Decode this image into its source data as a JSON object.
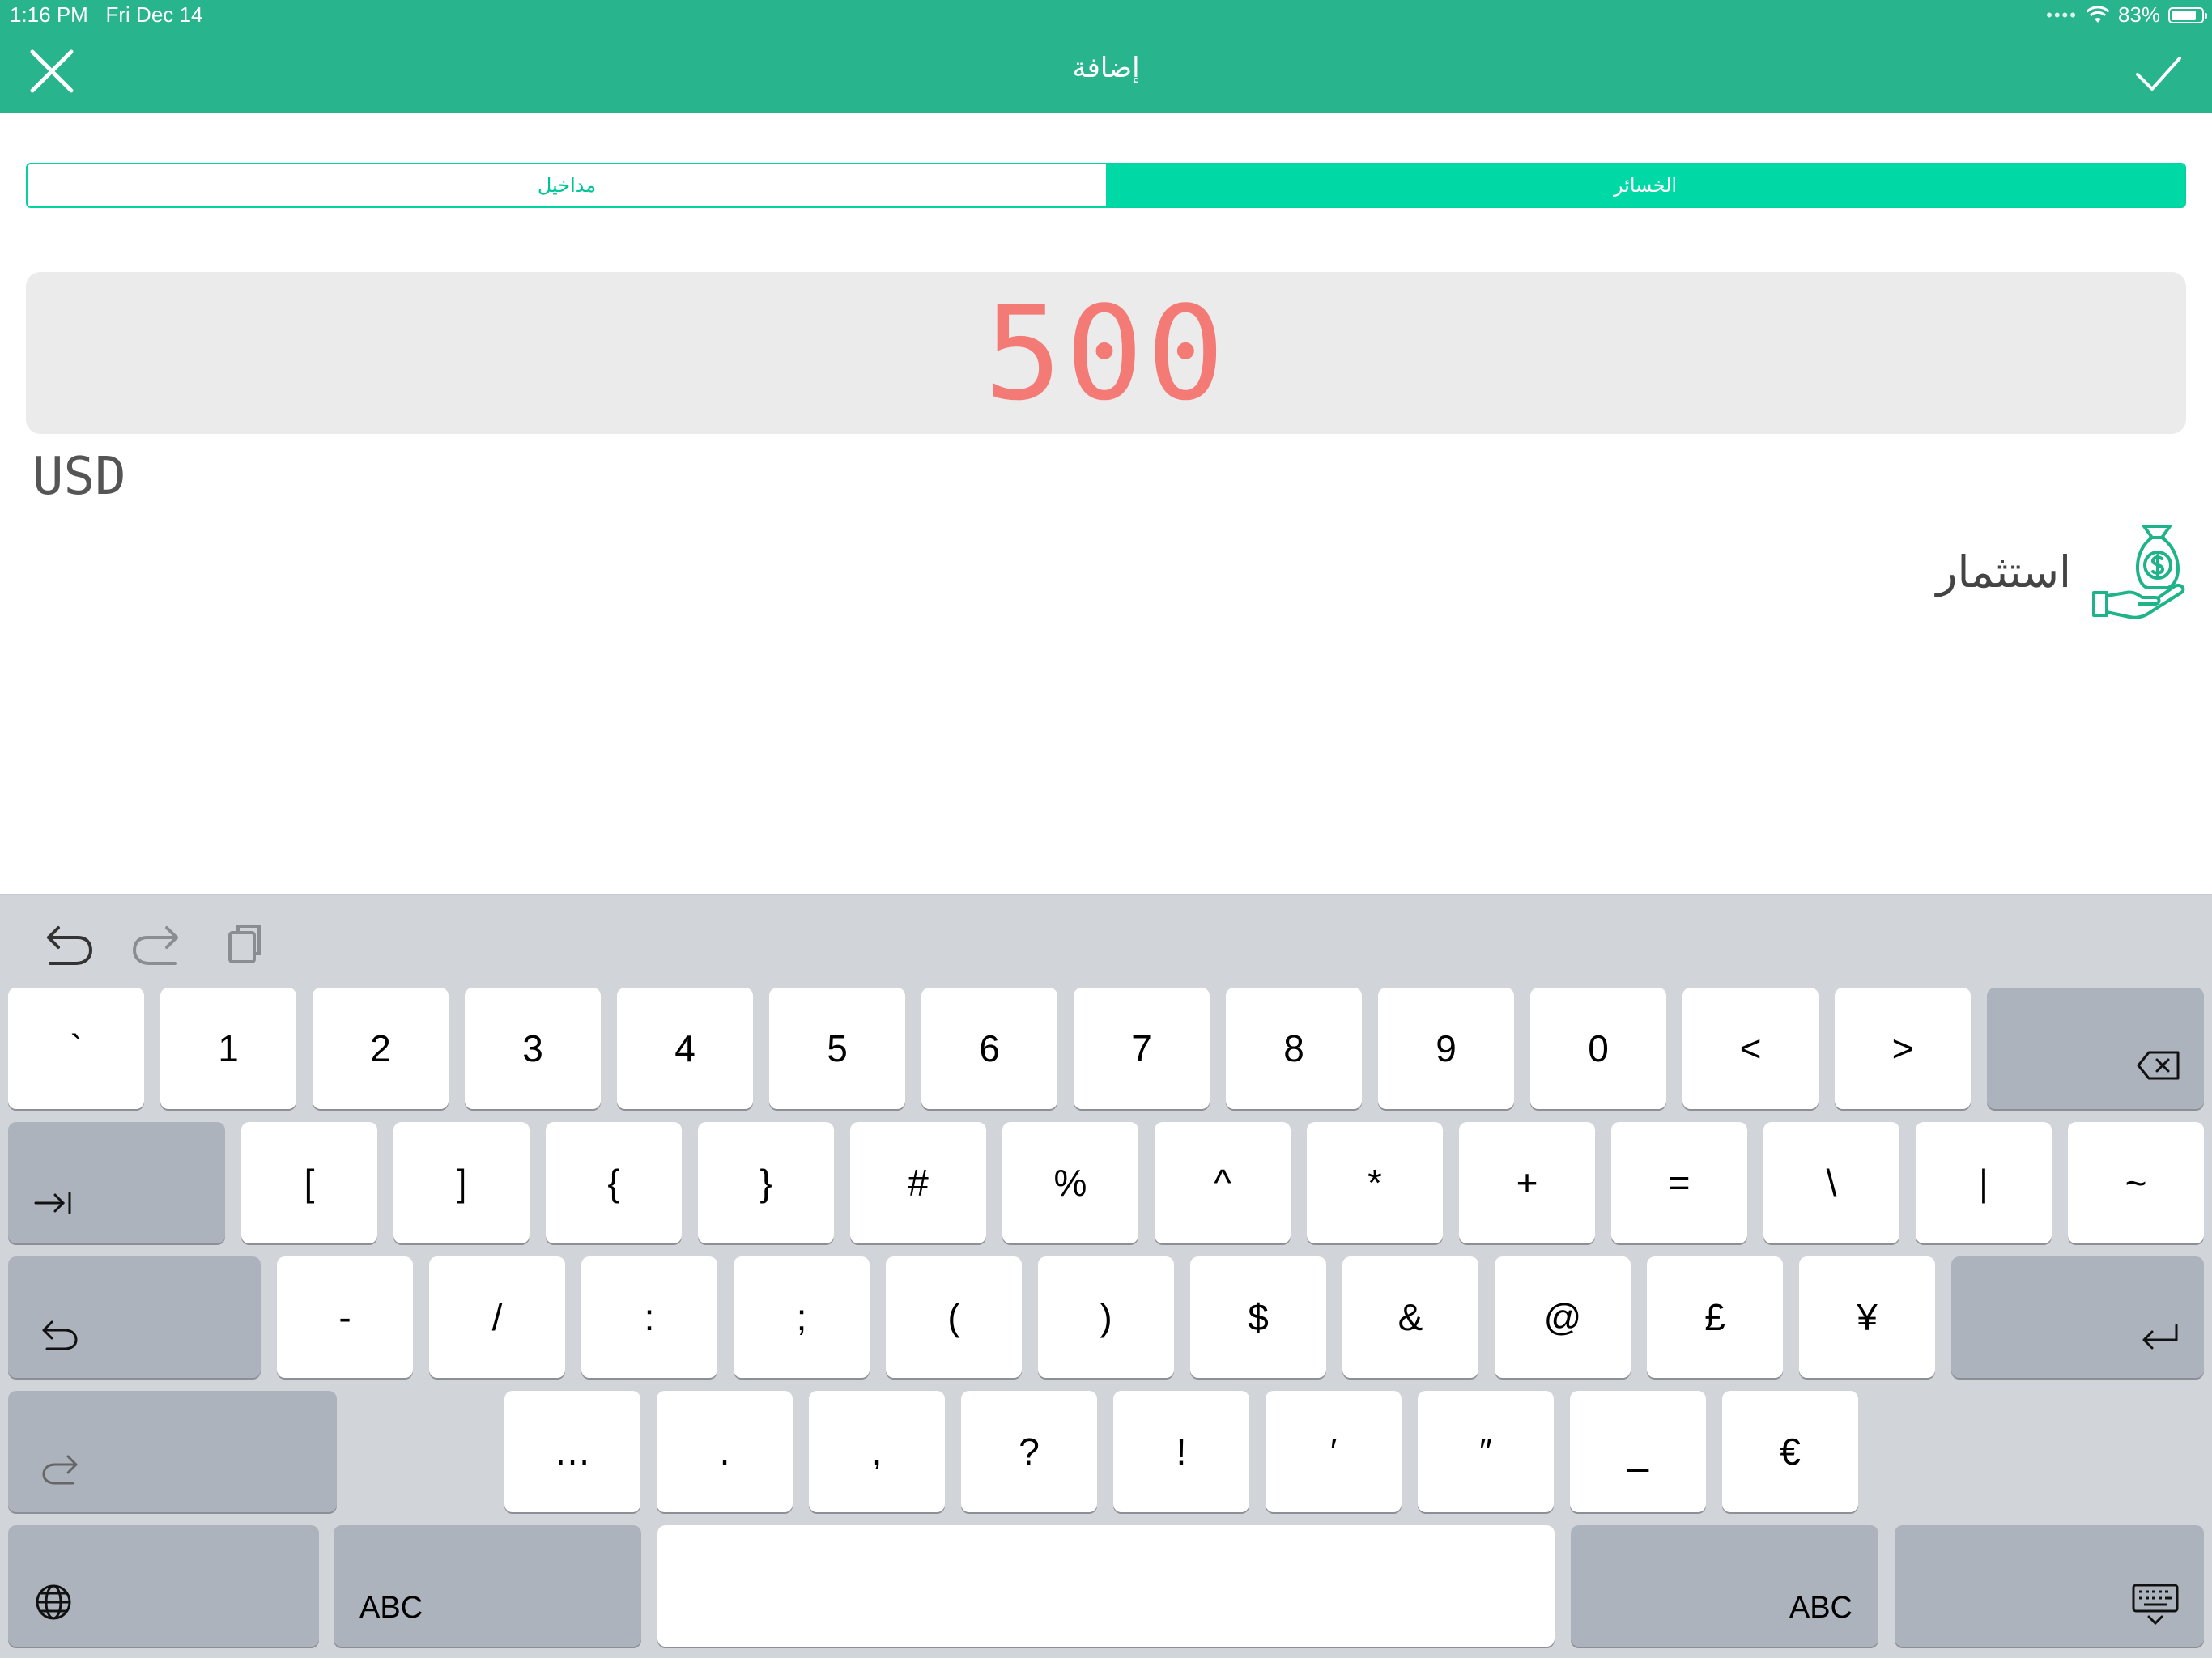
{
  "status_bar": {
    "time": "1:16 PM",
    "date": "Fri Dec 14",
    "battery": "83%",
    "battery_level": 0.83
  },
  "nav": {
    "title": "إضافة",
    "close_icon": "close-icon",
    "confirm_icon": "checkmark-icon"
  },
  "segment": {
    "income_label": "مداخيل",
    "loss_label": "الخسائر",
    "selected": "loss"
  },
  "amount": {
    "value": "500",
    "currency": "USD",
    "color": "#f47a76"
  },
  "category": {
    "label": "استثمار",
    "icon": "money-bag-hand-icon"
  },
  "colors": {
    "primary": "#28b48c",
    "segment_accent": "#00d9a6"
  },
  "keyboard": {
    "shortcuts": [
      "undo-icon",
      "redo-icon",
      "paste-icon"
    ],
    "row1": [
      "`",
      "1",
      "2",
      "3",
      "4",
      "5",
      "6",
      "7",
      "8",
      "9",
      "0",
      "<",
      ">"
    ],
    "row2": [
      "[",
      "]",
      "{",
      "}",
      "#",
      "%",
      "^",
      "*",
      "+",
      "=",
      "\\",
      "|",
      "~"
    ],
    "row3": [
      "-",
      "/",
      ":",
      ";",
      "(",
      ")",
      "$",
      "&",
      "@",
      "£",
      "¥"
    ],
    "row4": [
      "…",
      ".",
      ",",
      "?",
      "!",
      "′",
      "″",
      "_",
      "€"
    ],
    "abc_left": "ABC",
    "abc_right": "ABC"
  }
}
